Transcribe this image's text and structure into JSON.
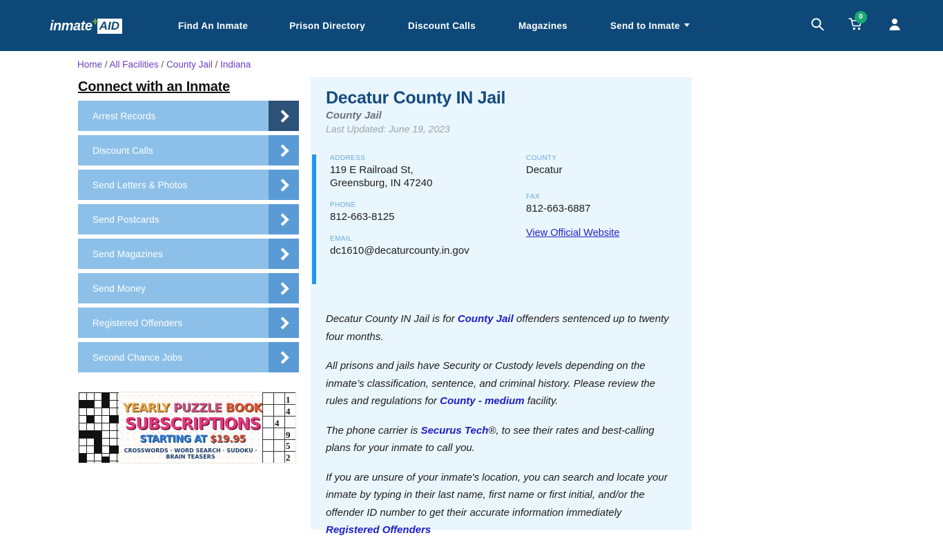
{
  "nav": {
    "logo": {
      "word": "inmate",
      "plus": "✛",
      "aid": "AID"
    },
    "links": [
      {
        "label": "Find An Inmate"
      },
      {
        "label": "Prison Directory"
      },
      {
        "label": "Discount Calls"
      },
      {
        "label": "Magazines"
      },
      {
        "label": "Send to Inmate"
      }
    ],
    "icons": {
      "search": "search-icon",
      "cart": "cart-icon",
      "cart_count": "0",
      "account": "user-icon"
    },
    "colors": {
      "bar": "#0d4878",
      "badge": "#19a974"
    }
  },
  "breadcrumb": {
    "items": [
      "Home",
      "All Facilities",
      "County Jail",
      "Indiana"
    ],
    "separator": "/"
  },
  "sidebar": {
    "title": "Connect with an Inmate",
    "items": [
      {
        "label": "Arrest Records",
        "active": true
      },
      {
        "label": "Discount Calls",
        "active": false
      },
      {
        "label": "Send Letters & Photos",
        "active": false
      },
      {
        "label": "Send Postcards",
        "active": false
      },
      {
        "label": "Send Magazines",
        "active": false
      },
      {
        "label": "Send Money",
        "active": false
      },
      {
        "label": "Registered Offenders",
        "active": false
      },
      {
        "label": "Second Chance Jobs",
        "active": false
      }
    ]
  },
  "ad": {
    "line1_a": "YEARLY ",
    "line1_b": "PUZZLE ",
    "line1_c": "BOOK",
    "line2": "SUBSCRIPTIONS",
    "line3_a": "STARTING AT ",
    "line3_b": "$19.95",
    "line4": "CROSSWORDS · WORD SEARCH · SUDOKU · BRAIN TEASERS",
    "sudoku_numbers": [
      "1",
      "4",
      "4",
      "9",
      "5",
      "2"
    ]
  },
  "facility": {
    "title": "Decatur County IN Jail",
    "subtitle": "County Jail",
    "last_updated": "Last Updated: June 19, 2023",
    "fields": {
      "address_label": "ADDRESS",
      "address_line1": "119 E Railroad St,",
      "address_line2": "Greensburg, IN 47240",
      "county_label": "COUNTY",
      "county_value": "Decatur",
      "phone_label": "PHONE",
      "phone_value": "812-663-8125",
      "fax_label": "FAX",
      "fax_value": "812-663-6887",
      "email_label": "EMAIL",
      "email_value": "dc1610@decaturcounty.in.gov",
      "website_link": "View Official Website"
    },
    "paragraphs": {
      "p1_a": "Decatur County IN Jail is for ",
      "p1_link": "County Jail",
      "p1_b": " offenders sentenced up to twenty four months.",
      "p2_a": "All prisons and jails have Security or Custody levels depending on the inmate’s classification, sentence, and criminal history. Please review the rules and regulations for ",
      "p2_link": "County - medium",
      "p2_b": " facility.",
      "p3_a": "The phone carrier is ",
      "p3_link": "Securus Tech",
      "p3_mark": "®",
      "p3_b": ", to see their rates and best-calling plans for your inmate to call you.",
      "p4_a": "If you are unsure of your inmate's location, you can search and locate your inmate by typing in their last name, first name or first initial, and/or the offender ID number to get their accurate information immediately ",
      "p4_link": "Registered Offenders"
    }
  }
}
